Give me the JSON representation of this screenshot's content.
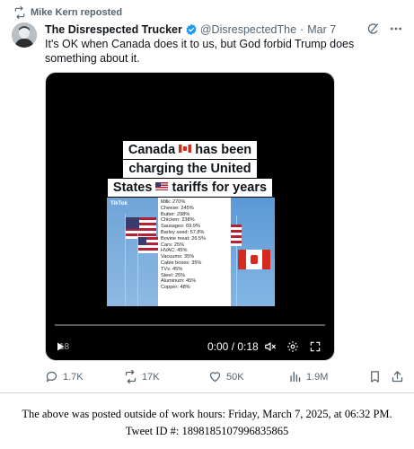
{
  "repost": {
    "text": "Mike Kern reposted"
  },
  "author": {
    "display_name": "The Disrespected Trucker",
    "handle": "@DisrespectedThe",
    "separator": "·",
    "date": "Mar 7"
  },
  "tweet": {
    "text": "It's OK when Canada does it to us, but God forbid Trump does something about it."
  },
  "video": {
    "caption_line1": "Canada",
    "caption_line1_rest": "has been",
    "caption_line2": "charging the United",
    "caption_line3": "States",
    "caption_line3_rest": "tariffs for years",
    "watermark_logo": "TikTok",
    "tariffs": [
      "Milk: 270%",
      "Cheese: 245%",
      "Butter: 298%",
      "Chicken: 238%",
      "Sausages: 69.9%",
      "Barley seed: 57.8%",
      "Bovine meat: 26.5%",
      "Cars: 25%",
      "HVAC: 45%",
      "Vacuums: 35%",
      "Cable boxes: 35%",
      "TVs: 45%",
      "Steel: 25%",
      "Aluminum: 45%",
      "Copper: 48%"
    ],
    "overlay_time": "18",
    "time_readout": "0:00 / 0:18",
    "progress": 0
  },
  "actions": {
    "replies": "1.7K",
    "reposts": "17K",
    "likes": "50K",
    "views": "1.9M"
  },
  "footer": {
    "line1": "The above was posted outside of work hours: Friday, March 7, 2025, at 06:32 PM.",
    "line2": "Tweet ID #: 1898185107996835865"
  },
  "colors": {
    "text_primary": "#0f1419",
    "text_secondary": "#536471",
    "verified_blue": "#1d9bf0",
    "divider": "#cfd9de"
  }
}
